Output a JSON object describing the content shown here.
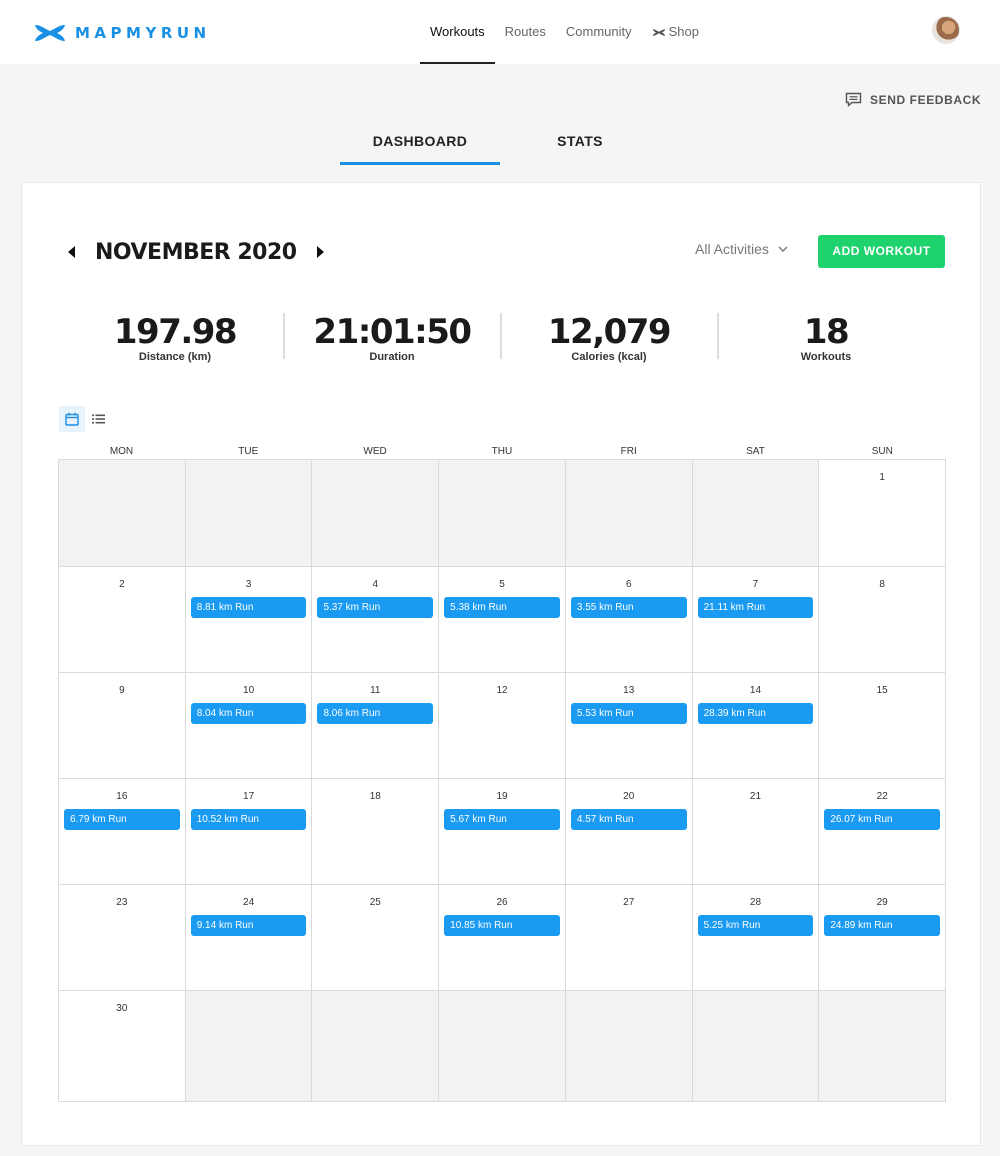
{
  "header": {
    "logo_text": "MAPMYRUN",
    "nav": [
      {
        "label": "Workouts",
        "active": true
      },
      {
        "label": "Routes",
        "active": false
      },
      {
        "label": "Community",
        "active": false
      },
      {
        "label": "Shop",
        "active": false
      }
    ]
  },
  "feedback": {
    "label": "SEND FEEDBACK",
    "icon": "chat-bubble-icon"
  },
  "tabs": [
    {
      "label": "DASHBOARD",
      "active": true
    },
    {
      "label": "STATS",
      "active": false
    }
  ],
  "calendar": {
    "month_title": "NOVEMBER 2020",
    "filter_label": "All Activities",
    "add_button": "ADD WORKOUT",
    "stats": [
      {
        "value": "197.98",
        "label": "Distance (km)"
      },
      {
        "value": "21:01:50",
        "label": "Duration"
      },
      {
        "value": "12,079",
        "label": "Calories (kcal)"
      },
      {
        "value": "18",
        "label": "Workouts"
      }
    ],
    "weekdays": [
      "MON",
      "TUE",
      "WED",
      "THU",
      "FRI",
      "SAT",
      "SUN"
    ],
    "weeks": [
      [
        {
          "day": ""
        },
        {
          "day": ""
        },
        {
          "day": ""
        },
        {
          "day": ""
        },
        {
          "day": ""
        },
        {
          "day": ""
        },
        {
          "day": "1"
        }
      ],
      [
        {
          "day": "2"
        },
        {
          "day": "3",
          "workout": "8.81 km Run"
        },
        {
          "day": "4",
          "workout": "5.37 km Run"
        },
        {
          "day": "5",
          "workout": "5.38 km Run"
        },
        {
          "day": "6",
          "workout": "3.55 km Run"
        },
        {
          "day": "7",
          "workout": "21.11 km Run"
        },
        {
          "day": "8"
        }
      ],
      [
        {
          "day": "9"
        },
        {
          "day": "10",
          "workout": "8.04 km Run"
        },
        {
          "day": "11",
          "workout": "8.06 km Run"
        },
        {
          "day": "12"
        },
        {
          "day": "13",
          "workout": "5.53 km Run"
        },
        {
          "day": "14",
          "workout": "28.39 km Run"
        },
        {
          "day": "15"
        }
      ],
      [
        {
          "day": "16",
          "workout": "6.79 km Run"
        },
        {
          "day": "17",
          "workout": "10.52 km Run"
        },
        {
          "day": "18"
        },
        {
          "day": "19",
          "workout": "5.67 km Run"
        },
        {
          "day": "20",
          "workout": "4.57 km Run"
        },
        {
          "day": "21"
        },
        {
          "day": "22",
          "workout": "26.07 km Run"
        }
      ],
      [
        {
          "day": "23"
        },
        {
          "day": "24",
          "workout": "9.14 km Run"
        },
        {
          "day": "25"
        },
        {
          "day": "26",
          "workout": "10.85 km Run"
        },
        {
          "day": "27"
        },
        {
          "day": "28",
          "workout": "5.25 km Run"
        },
        {
          "day": "29",
          "workout": "24.89 km Run"
        }
      ],
      [
        {
          "day": "30"
        },
        {
          "day": ""
        },
        {
          "day": ""
        },
        {
          "day": ""
        },
        {
          "day": ""
        },
        {
          "day": ""
        },
        {
          "day": ""
        }
      ]
    ]
  },
  "colors": {
    "brand": "#1a90e5",
    "workout_chip": "#1a9af0",
    "add_button": "#1ed26e",
    "empty_cell": "#f2f2f2"
  }
}
